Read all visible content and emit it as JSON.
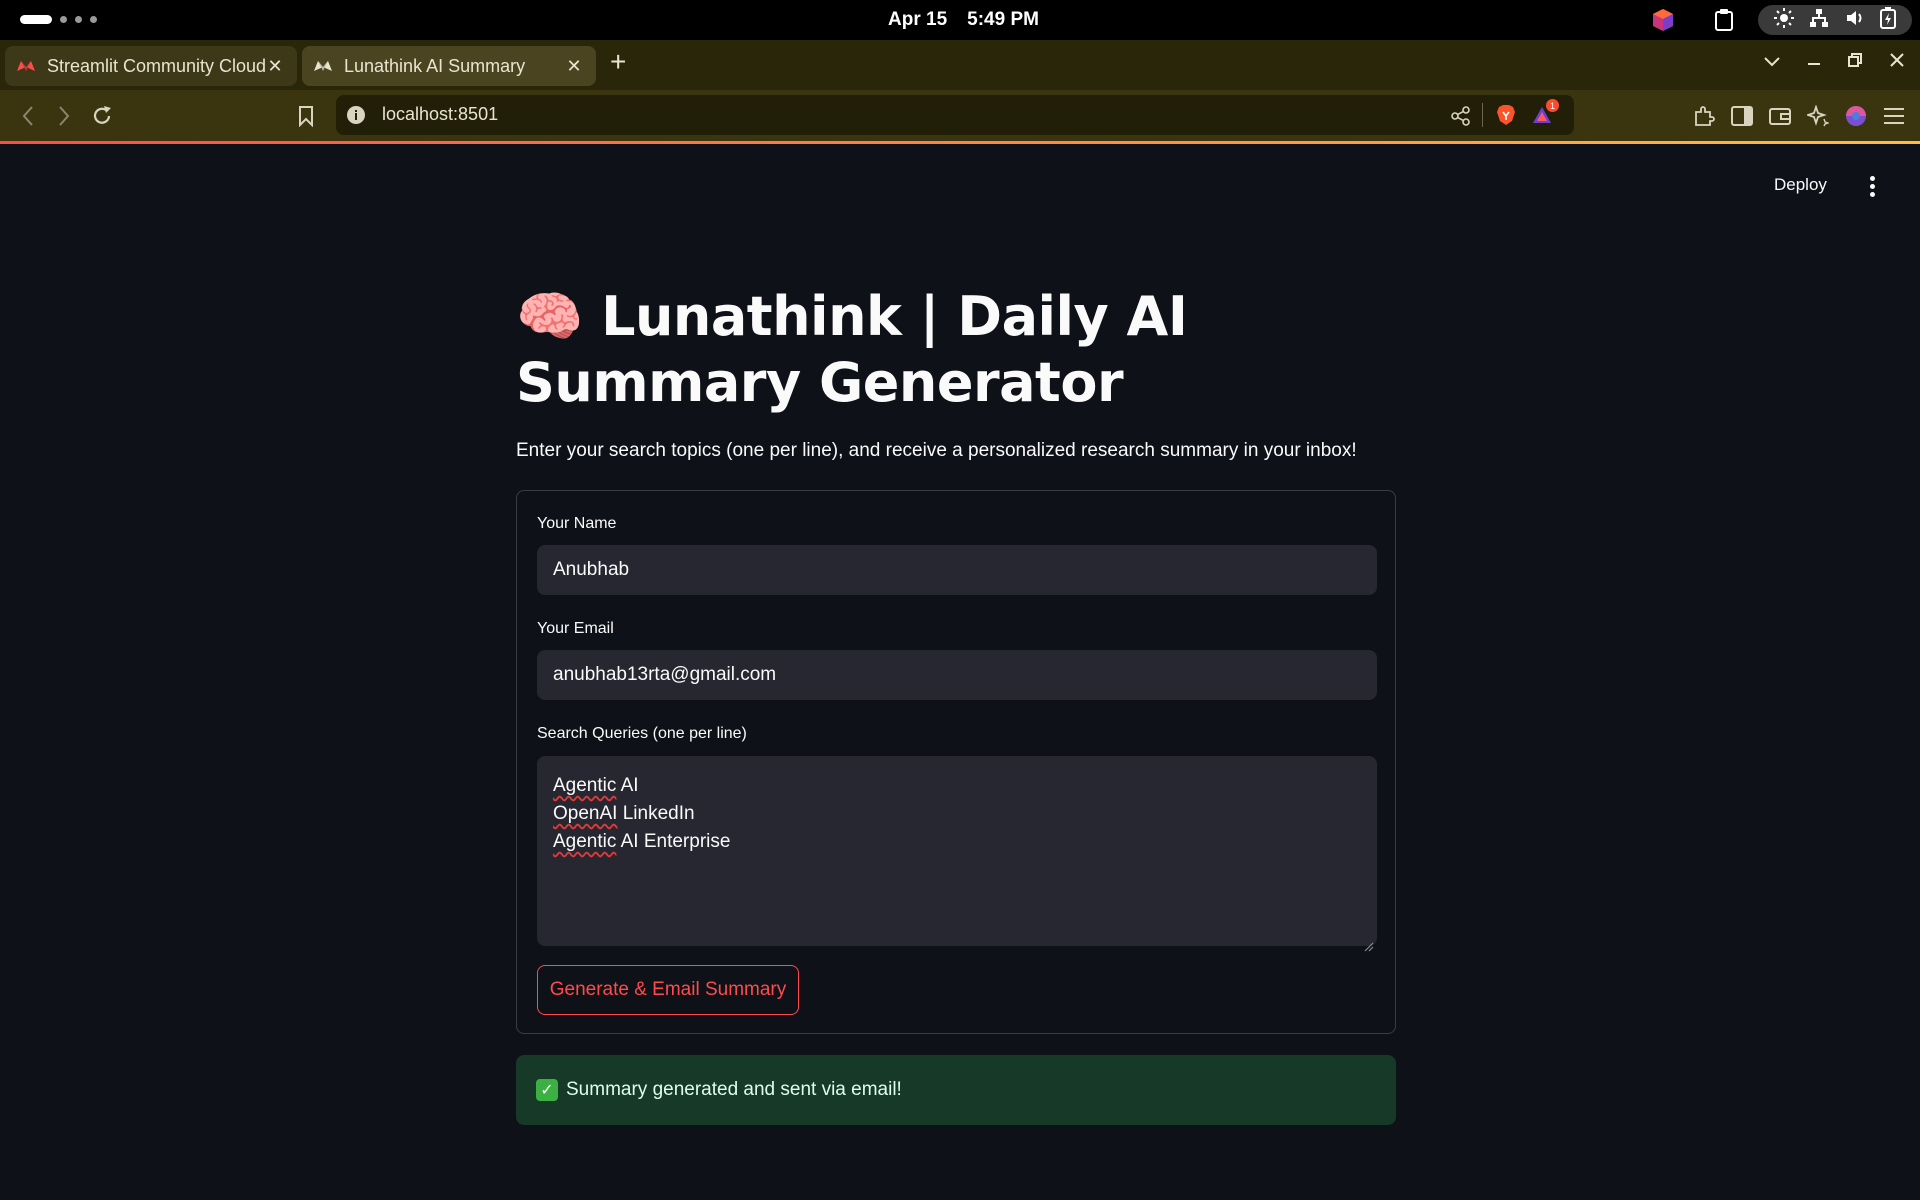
{
  "system": {
    "date": "Apr 15",
    "time": "5:49 PM"
  },
  "browser": {
    "tabs": [
      {
        "title": "Streamlit Community Cloud",
        "active": false
      },
      {
        "title": "Lunathink AI Summary",
        "active": true
      }
    ],
    "url": "localhost:8501",
    "notification_count": "1"
  },
  "app": {
    "deploy_label": "Deploy",
    "title_emoji": "🧠",
    "title": "Lunathink | Daily AI Summary Generator",
    "intro": "Enter your search topics (one per line), and receive a personalized research summary in your inbox!",
    "form": {
      "name_label": "Your Name",
      "name_value": "Anubhab",
      "email_label": "Your Email",
      "email_value": "anubhab13rta@gmail.com",
      "queries_label": "Search Queries (one per line)",
      "queries": [
        {
          "first": "Agentic",
          "rest": " AI"
        },
        {
          "first": "OpenAI",
          "rest": " LinkedIn"
        },
        {
          "first": "Agentic",
          "rest": " AI Enterprise"
        }
      ],
      "submit_label": "Generate & Email Summary"
    },
    "success_message": "Summary generated and sent via email!"
  },
  "colors": {
    "accent": "#ff4b4b",
    "background": "#0e1117",
    "input_bg": "#262730",
    "success_bg": "#173928"
  }
}
